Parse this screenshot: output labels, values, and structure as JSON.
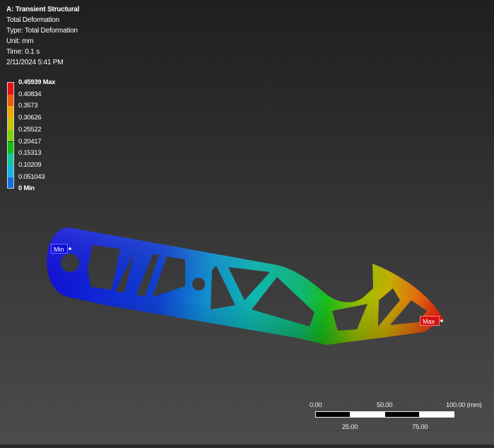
{
  "header": {
    "title": "A: Transient Structural",
    "lines": [
      "Total Deformation",
      "Type: Total Deformation",
      "Unit: mm",
      "Time: 0.1 s",
      "2/11/2024 5:41 PM"
    ]
  },
  "legend": {
    "labels": [
      "0.45939 Max",
      "0.40834",
      "0.3573",
      "0.30626",
      "0.25522",
      "0.20417",
      "0.15313",
      "0.10209",
      "0.051043",
      "0 Min"
    ],
    "colors": [
      "#e81010",
      "#f05a0c",
      "#f0a800",
      "#c8c800",
      "#7ed400",
      "#10c010",
      "#10c8a0",
      "#10b8e0",
      "#1070e0",
      "#1010e0"
    ]
  },
  "probes": {
    "min_label": "Min",
    "max_label": "Max"
  },
  "scale_bar": {
    "ticks_top": [
      "0.00",
      "50.00",
      "100.00 (mm)"
    ],
    "ticks_bottom": [
      "25.00",
      "75.00"
    ]
  },
  "colors": {
    "background_top": "#1f1f1f",
    "background_bottom": "#4c4c4c"
  }
}
